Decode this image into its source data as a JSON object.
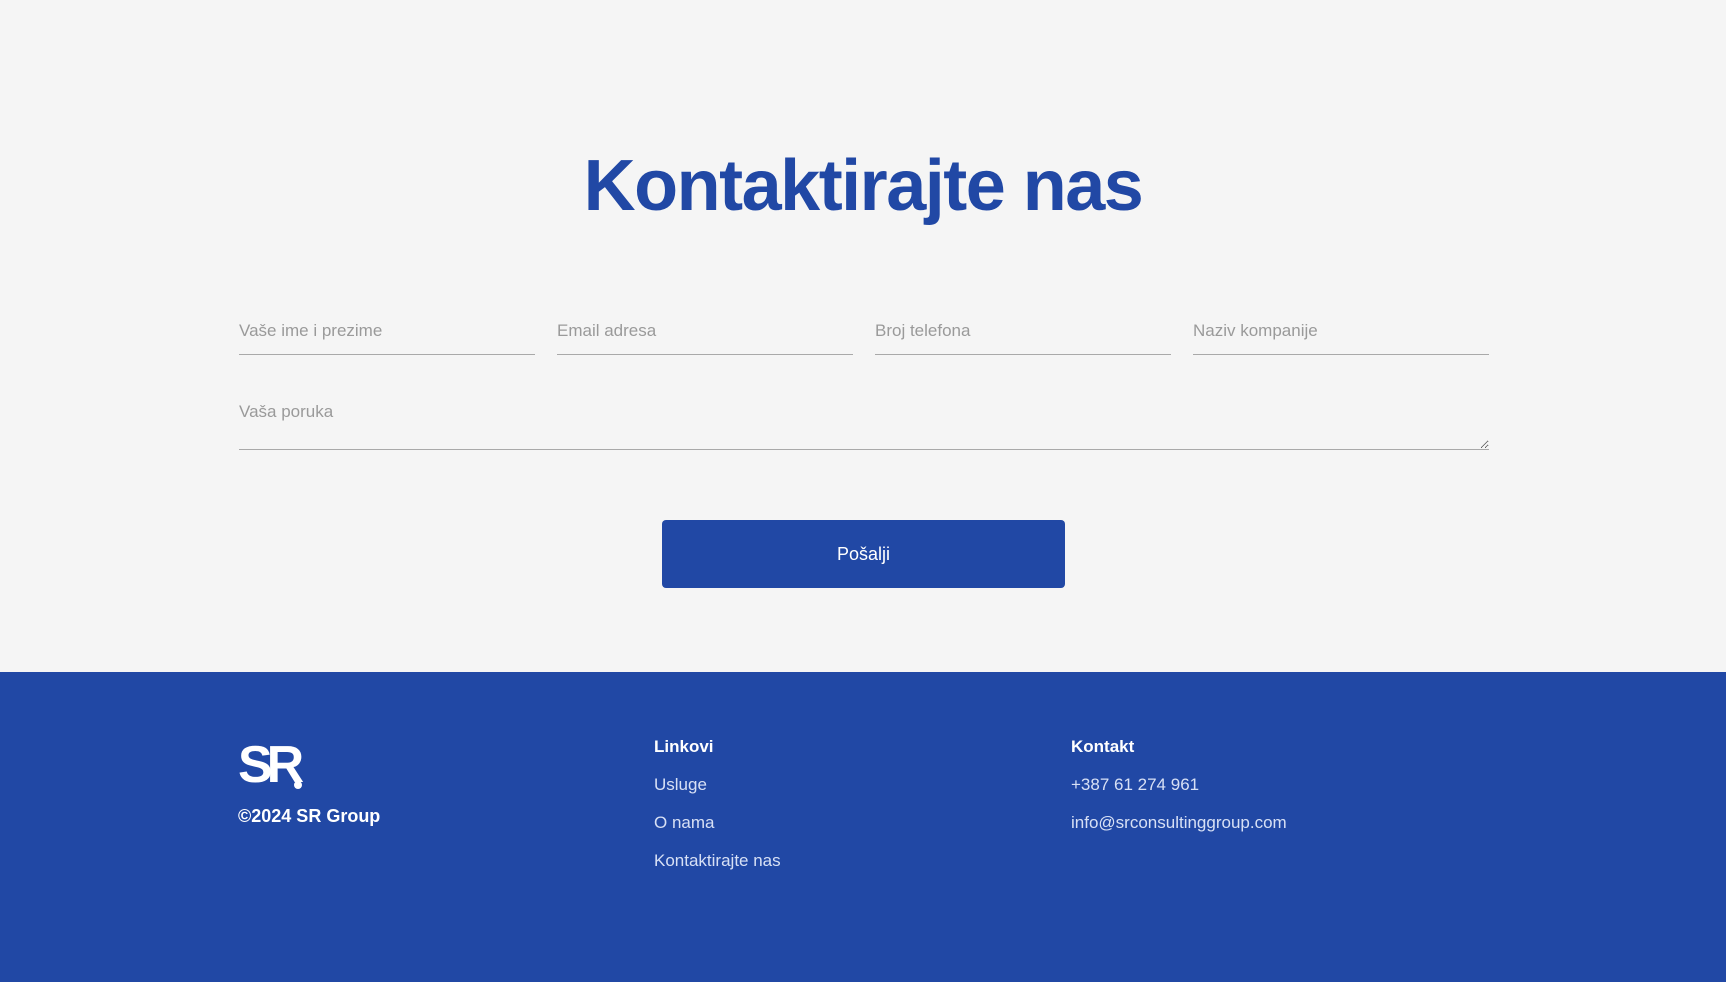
{
  "contact": {
    "title": "Kontaktirajte nas",
    "fields": {
      "name_placeholder": "Vaše ime i prezime",
      "email_placeholder": "Email adresa",
      "phone_placeholder": "Broj telefona",
      "company_placeholder": "Naziv kompanije",
      "message_placeholder": "Vaša poruka"
    },
    "submit_label": "Pošalji"
  },
  "footer": {
    "logo_text": "SR",
    "copyright": "©2024 SR Group",
    "links": {
      "heading": "Linkovi",
      "items": [
        "Usluge",
        "O nama",
        "Kontaktirajte nas"
      ]
    },
    "contact": {
      "heading": "Kontakt",
      "phone": "+387 61 274 961",
      "email": "info@srconsultinggroup.com"
    }
  },
  "colors": {
    "brand_blue": "#2148a5",
    "background": "#f5f5f5",
    "footer_link": "#d7e0f5"
  }
}
